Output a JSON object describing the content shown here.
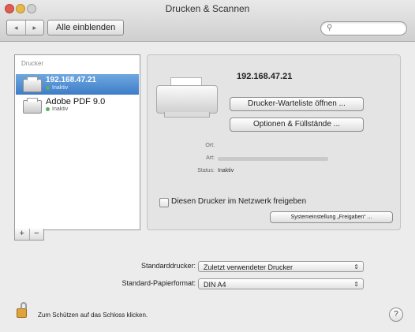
{
  "window": {
    "title": "Drucken & Scannen"
  },
  "toolbar": {
    "back_icon": "◂",
    "forward_icon": "▸",
    "show_all_label": "Alle einblenden",
    "search_icon": "magnifier-icon",
    "search_placeholder": ""
  },
  "sidebar": {
    "header": "Drucker",
    "printers": [
      {
        "name": "192.168.47.21",
        "status": "Inaktiv",
        "selected": true
      },
      {
        "name": "Adobe PDF 9.0",
        "status": "Inaktiv",
        "selected": false
      }
    ],
    "add_label": "+",
    "remove_label": "−"
  },
  "detail": {
    "printer_title": "192.168.47.21",
    "queue_button": "Drucker-Warteliste öffnen ...",
    "options_button": "Optionen & Füllstände ...",
    "info": {
      "location_label": "Ort:",
      "type_label": "Art:",
      "status_label": "Status:",
      "status_value": "Inaktiv"
    },
    "share_checkbox_label": "Diesen Drucker im Netzwerk freigeben",
    "share_checked": false,
    "system_settings_button": "Systemeinstellung „Freigaben“ ..."
  },
  "bottom": {
    "default_printer_label": "Standarddrucker:",
    "default_printer_value": "Zuletzt verwendeter Drucker",
    "paper_format_label": "Standard-Papierformat:",
    "paper_format_value": "DIN A4",
    "lock_text": "Zum Schützen auf das Schloss klicken.",
    "help_label": "?"
  },
  "colors": {
    "selection": "#3e7cc8",
    "status_dot": "#5bb15b",
    "close": "#e25b4f",
    "minimize": "#e6b847"
  }
}
